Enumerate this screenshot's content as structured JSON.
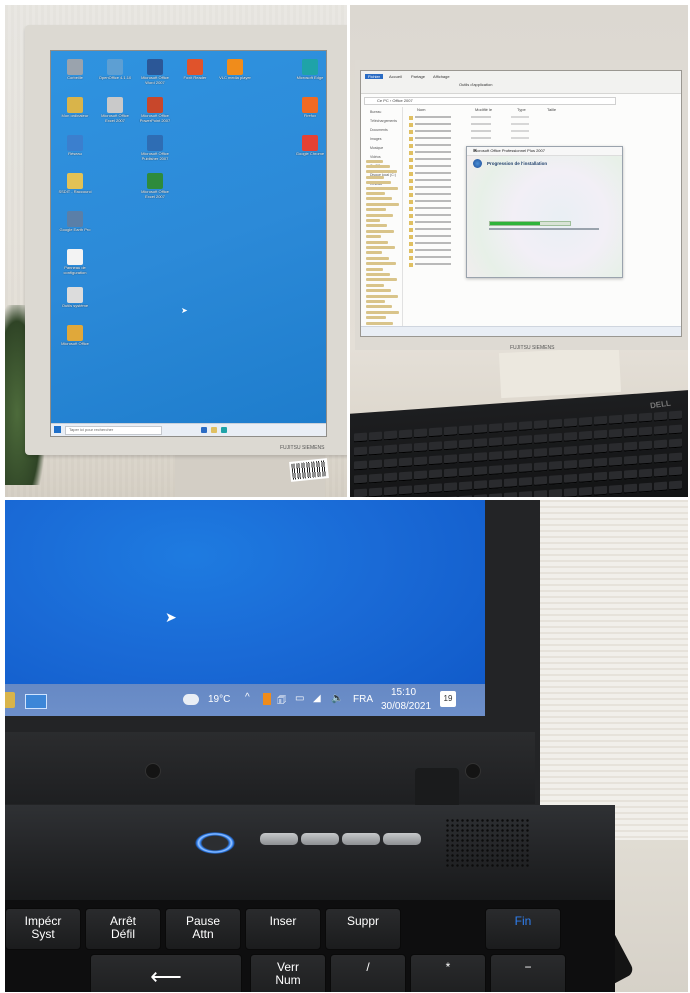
{
  "panel1": {
    "desktop_icons": [
      {
        "label": "Corbeille",
        "color": "#9aa3ad"
      },
      {
        "label": "OpenOffice 4.1.10",
        "color": "#5d9fd3"
      },
      {
        "label": "Microsoft Office Word 2007",
        "color": "#2b5797"
      },
      {
        "label": "Foxit Reader",
        "color": "#e0532b"
      },
      {
        "label": "VLC media player",
        "color": "#f08c1b"
      },
      {
        "label": "Microsoft Edge",
        "color": "#1fa3a8"
      },
      {
        "label": "Mon ordinateur",
        "color": "#d9b44a"
      },
      {
        "label": "Microsoft Office Excel 2007",
        "color": "#c9c9c9"
      },
      {
        "label": "Microsoft Office PowerPoint 2007",
        "color": "#c8472b"
      },
      {
        "label": "Firefox",
        "color": "#f06a22"
      },
      {
        "label": "Réseau",
        "color": "#3b7fce"
      },
      {
        "label": "Microsoft Office Publisher 2007",
        "color": "#2e6db4"
      },
      {
        "label": "Google Chrome",
        "color": "#e44134"
      },
      {
        "label": "SSDIT - Raccourci",
        "color": "#e2c256"
      },
      {
        "label": "Microsoft Office Excel 2007",
        "color": "#2e8b3c"
      },
      {
        "label": "Google Earth Pro",
        "color": "#5a7fa8"
      },
      {
        "label": "Panneau de configuration",
        "color": "#f3f3f3"
      },
      {
        "label": "Outils système",
        "color": "#dcdcdc"
      },
      {
        "label": "Microsoft Office",
        "color": "#e0a83a"
      }
    ],
    "search_text": "Taper ici pour rechercher",
    "monitor_brand": "FUJITSU SIEMENS"
  },
  "panel2": {
    "ribbon_tabs": [
      "Fichier",
      "Accueil",
      "Partage",
      "Affichage",
      "Outils d'application"
    ],
    "address_text": "Ce PC › Office 2007",
    "column_headers": [
      "Nom",
      "Modifié le",
      "Type",
      "Taille"
    ],
    "sidebar_items": [
      "Bureau",
      "Téléchargements",
      "Documents",
      "Images",
      "Musique",
      "Vidéos",
      "Ce PC",
      "Disque local (C:)",
      "Réseau"
    ],
    "dialog": {
      "title": "Microsoft Office Professionnel Plus 2007",
      "heading": "Progression de l'installation",
      "progress": 0.62,
      "progress_color": "#2fb33a"
    },
    "keyboard_brand": "DELL",
    "monitor_brand": "FUJITSU SIEMENS"
  },
  "panel3": {
    "taskbar": {
      "weather": "19°C",
      "language": "FRA",
      "time": "15:10",
      "date": "30/08/2021",
      "notification_count": "19"
    },
    "keys": [
      {
        "top": "Impécr",
        "bottom": "Syst"
      },
      {
        "top": "Arrêt",
        "bottom": "Défil"
      },
      {
        "top": "Pause",
        "bottom": "Attn"
      },
      {
        "top": "Inser",
        "bottom": ""
      },
      {
        "top": "Suppr",
        "bottom": ""
      },
      {
        "top": "",
        "bottom": "Fin"
      },
      {
        "top": "Verr",
        "bottom": "Num"
      },
      {
        "top": "/",
        "bottom": ""
      },
      {
        "top": "*",
        "bottom": ""
      },
      {
        "top": "−",
        "bottom": ""
      }
    ],
    "accent_blue": "#2f7ff0"
  }
}
